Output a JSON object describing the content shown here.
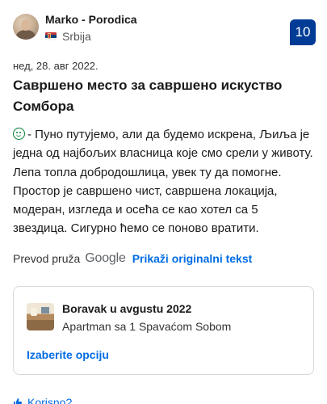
{
  "reviewer": {
    "name": "Marko - Porodica",
    "country": "Srbija",
    "score": "10"
  },
  "review": {
    "date": "нед, 28. авг 2022.",
    "title": "Савршено место за савршено искуство Сомбора",
    "positive_text": "- Пуно путујемо, али да будемо искрена, Љиља је једна од најбољих власница које смо срели у животу. Лепа топла добродошлица, увек ту да помогне. Простор је савршено чист, савршена локација, модеран, изгледа и осећа се као хотел са 5 звездица. Сигурно ћемо се поново вратити."
  },
  "translation": {
    "provided_by": "Prevod pruža",
    "provider": "Google",
    "show_original": "Prikaži originalni tekst"
  },
  "stay_card": {
    "title": "Boravak u avgustu 2022",
    "room": "Apartman sa 1 Spavaćom Sobom",
    "action": "Izaberite opciju"
  },
  "footer": {
    "helpful": "Korisno?"
  },
  "colors": {
    "score_bg": "#003b95",
    "link": "#006ce4",
    "positive": "#008234"
  }
}
